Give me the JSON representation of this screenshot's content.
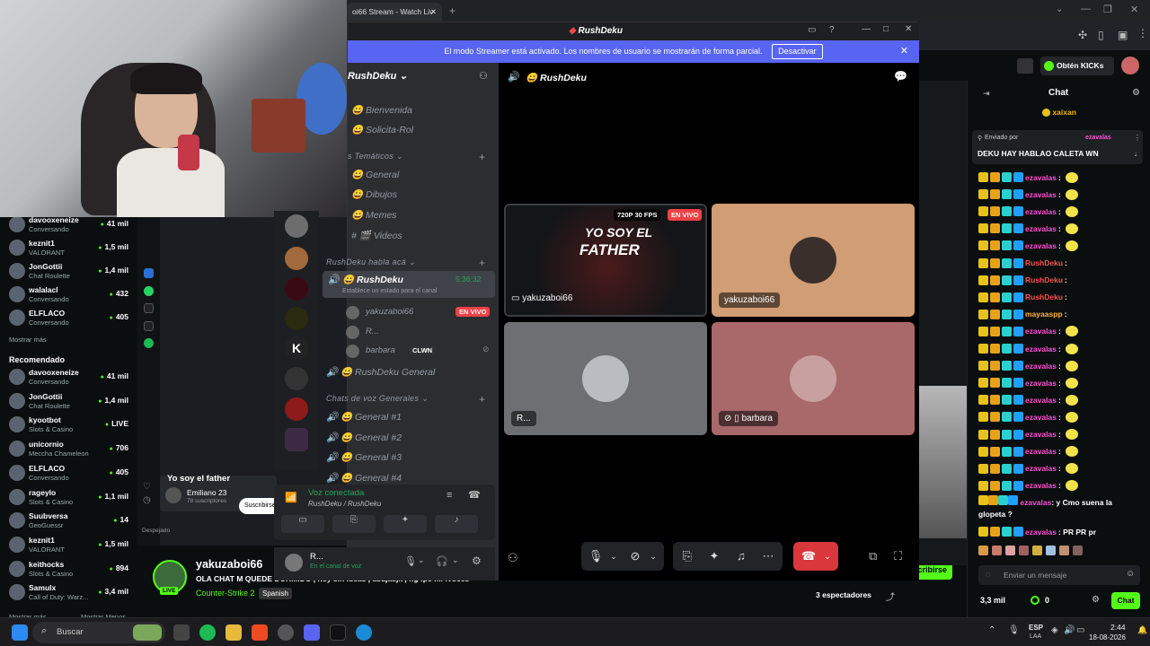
{
  "browser": {
    "tab_title": "oi66 Stream - Watch Liv"
  },
  "kick": {
    "kick_button": "Obtén KICKs",
    "sidebar_top": [
      {
        "name": "davooxeneize",
        "sub": "Conversando",
        "viewers": "41 mil"
      },
      {
        "name": "keznit1",
        "sub": "VALORANT",
        "viewers": "1,5 mil"
      },
      {
        "name": "JonGottii",
        "sub": "Chat Roulette",
        "viewers": "1,4 mil"
      },
      {
        "name": "walalacl",
        "sub": "Conversando",
        "viewers": "432"
      },
      {
        "name": "ELFLACO",
        "sub": "Conversando",
        "viewers": "405"
      }
    ],
    "show_more": "Mostrar más",
    "recommended_heading": "Recomendado",
    "recommended": [
      {
        "name": "davooxeneize",
        "sub": "Conversando",
        "viewers": "41 mil"
      },
      {
        "name": "JonGottii",
        "sub": "Chat Roulette",
        "viewers": "1,4 mil"
      },
      {
        "name": "kyootbot",
        "sub": "Slots & Casino",
        "viewers": "LIVE"
      },
      {
        "name": "unicornio",
        "sub": "Meccha Chameleon",
        "viewers": "706"
      },
      {
        "name": "ELFLACO",
        "sub": "Conversando",
        "viewers": "405"
      },
      {
        "name": "rageylo",
        "sub": "Slots & Casino",
        "viewers": "1,1 mil"
      },
      {
        "name": "Suubversa",
        "sub": "GeoGuessr",
        "viewers": "14"
      },
      {
        "name": "keznit1",
        "sub": "VALORANT",
        "viewers": "1,5 mil"
      },
      {
        "name": "keithocks",
        "sub": "Slots & Casino",
        "viewers": "894"
      },
      {
        "name": "Samulx",
        "sub": "Call of Duty: Warz...",
        "viewers": "3,4 mil"
      }
    ],
    "show_more_2": "Mostrar más",
    "show_less": "Mostrar Menos",
    "popup_title": "Yo soy el father",
    "popup_channel": "Emiliano 23",
    "popup_subs": "78 suscriptores",
    "popup_btn": "Suscribirse",
    "weather": "Despejado",
    "live_badge": "LIVE",
    "streamer": "yakuzaboi66",
    "stream_title": "OLA CHAT M QUEDE DORMIDO | hoy sin ideas | asdjasjk | !ig !pc !M !voces",
    "category": "Counter-Strike 2",
    "language": "Spanish",
    "spectators": "3 espectadores",
    "follow_btn": "cribirse",
    "chat_title": "Chat",
    "chat_pinned_user": "xaixan",
    "chat_pinned_by": "Enviado por",
    "chat_pinned_sender": "ezavalas",
    "chat_pinned_msg": "DEKU HAY HABLAO CALETA WN",
    "chat_messages": [
      {
        "user": "ezavalas",
        "color": "#ff4fd8",
        "text": ":",
        "emoji": true
      },
      {
        "user": "ezavalas",
        "color": "#ff4fd8",
        "text": ":",
        "emoji": true
      },
      {
        "user": "ezavalas",
        "color": "#ff4fd8",
        "text": ":",
        "emoji": true
      },
      {
        "user": "ezavalas",
        "color": "#ff4fd8",
        "text": ":",
        "emoji": true
      },
      {
        "user": "ezavalas",
        "color": "#ff4fd8",
        "text": ":",
        "emoji": true
      },
      {
        "user": "RushDeku",
        "color": "#ff4f4f",
        "text": ":",
        "emoji": false
      },
      {
        "user": "RushDeku",
        "color": "#ff4f4f",
        "text": ":",
        "emoji": false
      },
      {
        "user": "RushDeku",
        "color": "#ff4f4f",
        "text": ":",
        "emoji": false
      },
      {
        "user": "mayaaspp",
        "color": "#ffb040",
        "text": ":",
        "emoji": false
      },
      {
        "user": "ezavalas",
        "color": "#ff4fd8",
        "text": ":",
        "emoji": true
      },
      {
        "user": "ezavalas",
        "color": "#ff4fd8",
        "text": ":",
        "emoji": true
      },
      {
        "user": "ezavalas",
        "color": "#ff4fd8",
        "text": ":",
        "emoji": true
      },
      {
        "user": "ezavalas",
        "color": "#ff4fd8",
        "text": ":",
        "emoji": true
      },
      {
        "user": "ezavalas",
        "color": "#ff4fd8",
        "text": ":",
        "emoji": true
      },
      {
        "user": "ezavalas",
        "color": "#ff4fd8",
        "text": ":",
        "emoji": true
      },
      {
        "user": "ezavalas",
        "color": "#ff4fd8",
        "text": ":",
        "emoji": true
      },
      {
        "user": "ezavalas",
        "color": "#ff4fd8",
        "text": ":",
        "emoji": true
      },
      {
        "user": "ezavalas",
        "color": "#ff4fd8",
        "text": ":",
        "emoji": true
      },
      {
        "user": "ezavalas",
        "color": "#ff4fd8",
        "text": ":",
        "emoji": true
      }
    ],
    "chat_long_user": "ezavalas",
    "chat_long_msg": ": y Cmo suena la glopeta ?",
    "chat_last_user": "ezavalas",
    "chat_last_msg": ": PR PR pr",
    "chat_input_placeholder": "Enviar un mensaje",
    "chat_count": "3,3 mil",
    "chat_kicks": "0",
    "chat_send": "Chat"
  },
  "discord": {
    "window_title": "RushDeku",
    "banner_text": "El modo Streamer está activado. Los nombres de usuario se mostrarán de forma parcial.",
    "banner_button": "Desactivar",
    "server_name": "RushDeku",
    "channels_top": [
      "Bienvenida",
      "Solicita-Rol"
    ],
    "category_tematicos": "Temáticos",
    "channels_tematicos": [
      "General",
      "Dibujos",
      "Memes",
      "Videos"
    ],
    "category_habla": "RushDeku habla acá",
    "voice_channel": "RushDeku",
    "voice_time": "5:36:32",
    "voice_status": "Establece un estado para el canal",
    "voice_users": [
      {
        "name": "yakuzaboi66",
        "badge": "EN VIVO"
      },
      {
        "name": "R...",
        "badge": ""
      },
      {
        "name": "barbara",
        "badge": "CLWN"
      }
    ],
    "channel_general_voice": "RushDeku General",
    "category_voz": "Chats de voz Generales",
    "voice_channels": [
      "General #1",
      "General #2",
      "General #3",
      "General #4"
    ],
    "voice_connected": "Voz conectada",
    "voice_connected_sub": "RushDeku / RushDeku",
    "user_name": "R...",
    "user_status": "En el canal de voz",
    "call_header": "RushDeku",
    "tiles": [
      {
        "label": "yakuzaboi66",
        "stream_quality": "720P 30 FPS",
        "live": "EN VIVO",
        "stream_text_1": "YO SOY EL",
        "stream_text_2": "FATHER"
      },
      {
        "label": "yakuzaboi66"
      },
      {
        "label": "R..."
      },
      {
        "label": "barbara"
      }
    ]
  },
  "taskbar": {
    "search_placeholder": "Buscar",
    "lang": "ESP",
    "lang_sub": "LAA",
    "time": "2:44",
    "date": "18-08-2026"
  }
}
